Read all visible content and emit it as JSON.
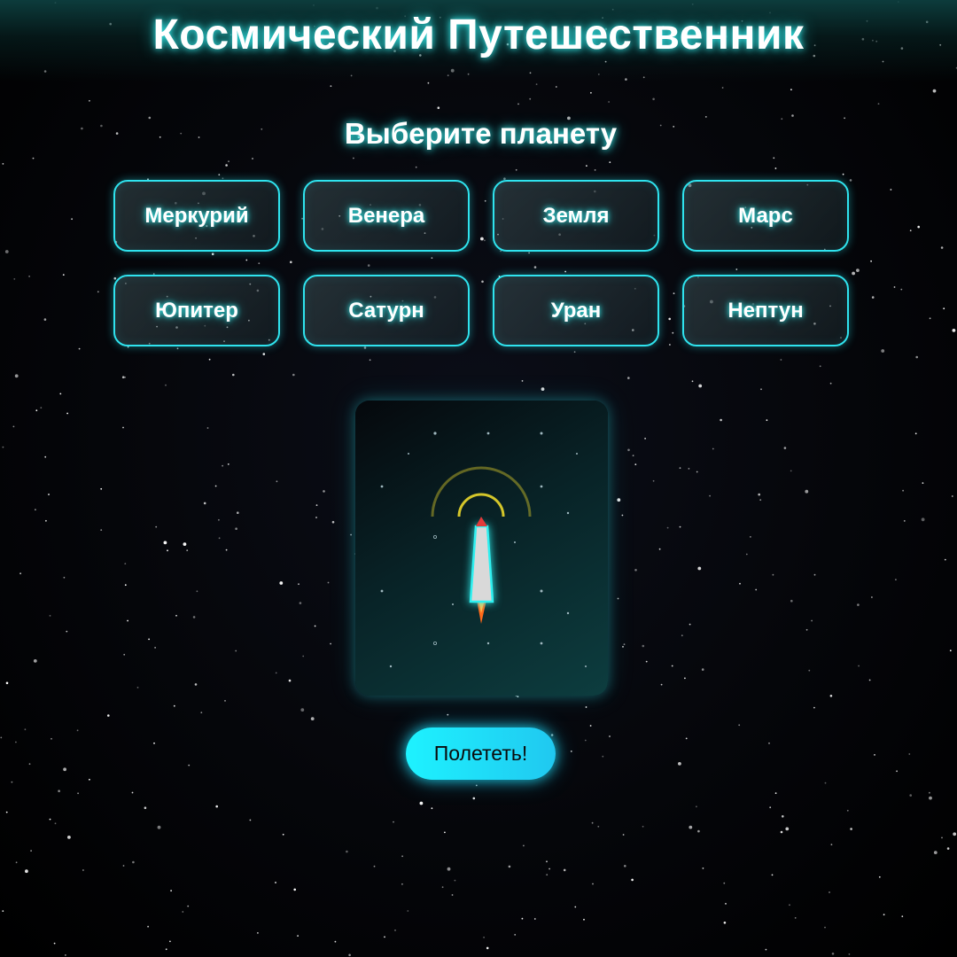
{
  "header": {
    "title": "Космический Путешественник"
  },
  "selector": {
    "heading": "Выберите планету",
    "planets": [
      {
        "id": "mercury",
        "label": "Меркурий"
      },
      {
        "id": "venus",
        "label": "Венера"
      },
      {
        "id": "earth",
        "label": "Земля"
      },
      {
        "id": "mars",
        "label": "Марс"
      },
      {
        "id": "jupiter",
        "label": "Юпитер"
      },
      {
        "id": "saturn",
        "label": "Сатурн"
      },
      {
        "id": "uranus",
        "label": "Уран"
      },
      {
        "id": "neptune",
        "label": "Нептун"
      }
    ]
  },
  "scene": {
    "rocket_icon": "rocket-icon",
    "signal_icon": "signal-arcs-icon"
  },
  "actions": {
    "fly_label": "Полететь!"
  },
  "colors": {
    "accent": "#2fe3ee",
    "button": "#1ef2ff",
    "signal": "#d4c62a",
    "rocket_tip": "#e23a3a",
    "flame": "#ff6a1a"
  }
}
